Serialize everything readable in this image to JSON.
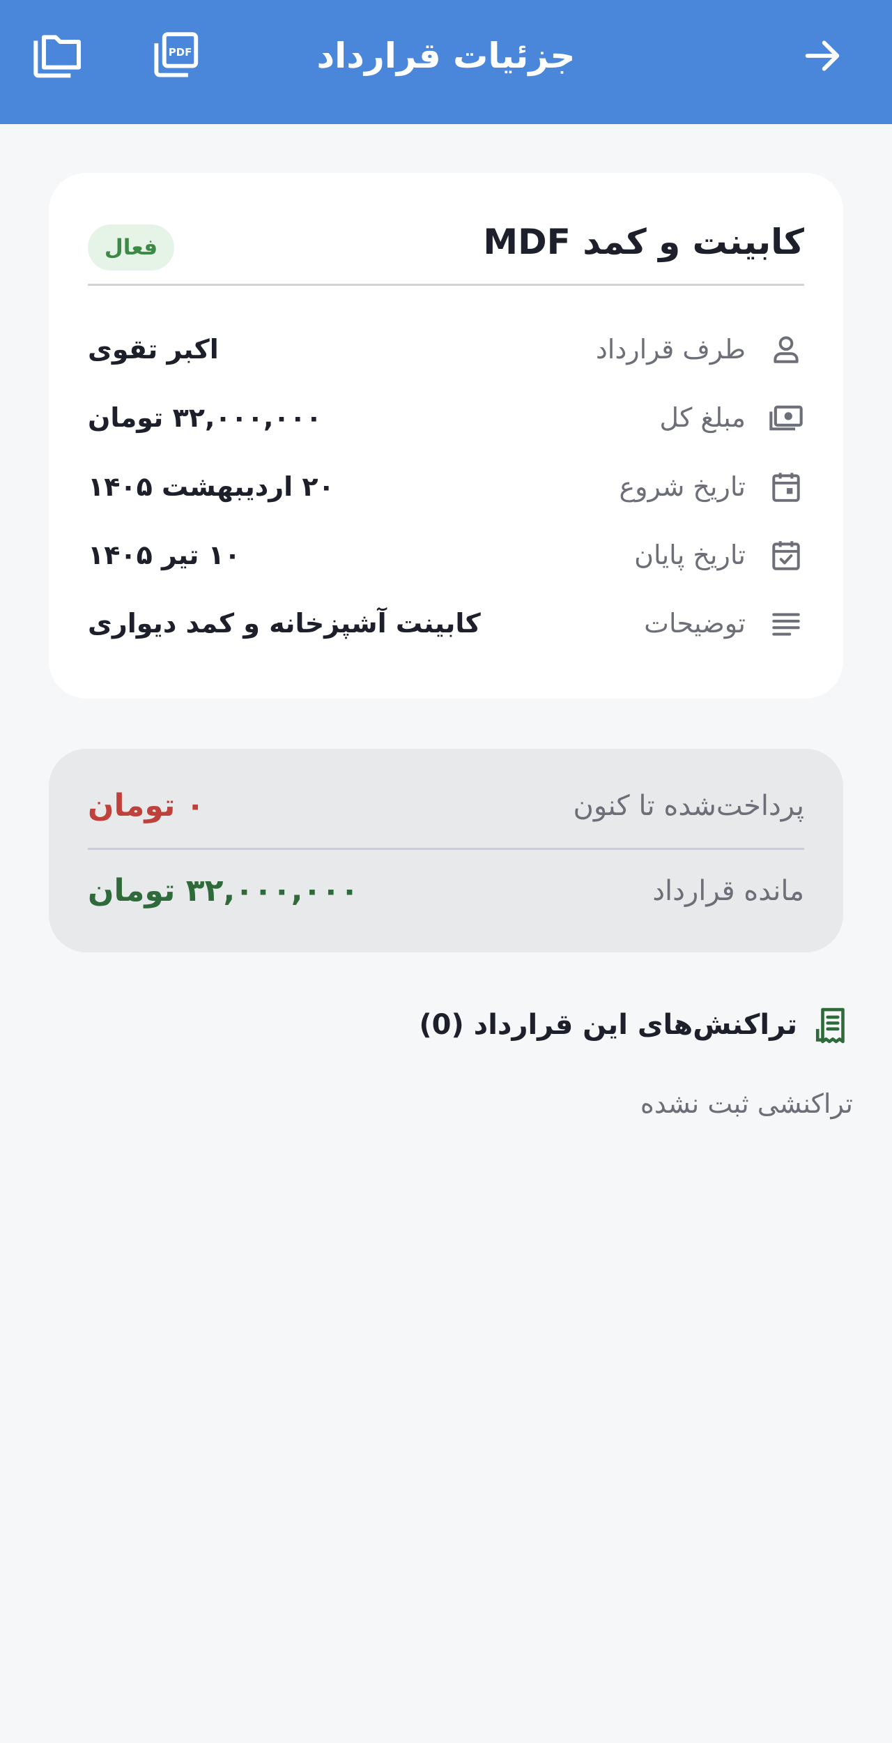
{
  "header": {
    "title": "جزئیات قرارداد",
    "icons": [
      "arrow-right-icon",
      "pdf-icon",
      "folder-icon"
    ]
  },
  "contract": {
    "title": "کابینت و کمد MDF",
    "status": "فعال",
    "rows": [
      {
        "icon": "person-icon",
        "label": "طرف قرارداد",
        "value": "اکبر تقوی"
      },
      {
        "icon": "money-icon",
        "label": "مبلغ کل",
        "value": "۳۲,۰۰۰,۰۰۰ تومان"
      },
      {
        "icon": "calendar-icon",
        "label": "تاریخ شروع",
        "value": "۲۰ اردیبهشت ۱۴۰۵"
      },
      {
        "icon": "calendar-check-icon",
        "label": "تاریخ پایان",
        "value": "۱۰ تیر ۱۴۰۵"
      },
      {
        "icon": "notes-icon",
        "label": "توضیحات",
        "value": "کابینت آشپزخانه و کمد دیواری"
      }
    ]
  },
  "summary": {
    "paid_label": "پرداخت‌شده تا کنون",
    "paid_value": "۰ تومان",
    "remaining_label": "مانده قرارداد",
    "remaining_value": "۳۲,۰۰۰,۰۰۰ تومان"
  },
  "transactions": {
    "title": "تراکنش‌های این قرارداد (0)",
    "empty_text": "تراکنشی ثبت نشده"
  },
  "colors": {
    "appbar": "#4a87db",
    "status_bg": "#e6f3e7",
    "status_text": "#3c8a45",
    "paid": "#c0413b",
    "remaining": "#2f6b3a",
    "receipt_icon": "#2f6b3a"
  }
}
